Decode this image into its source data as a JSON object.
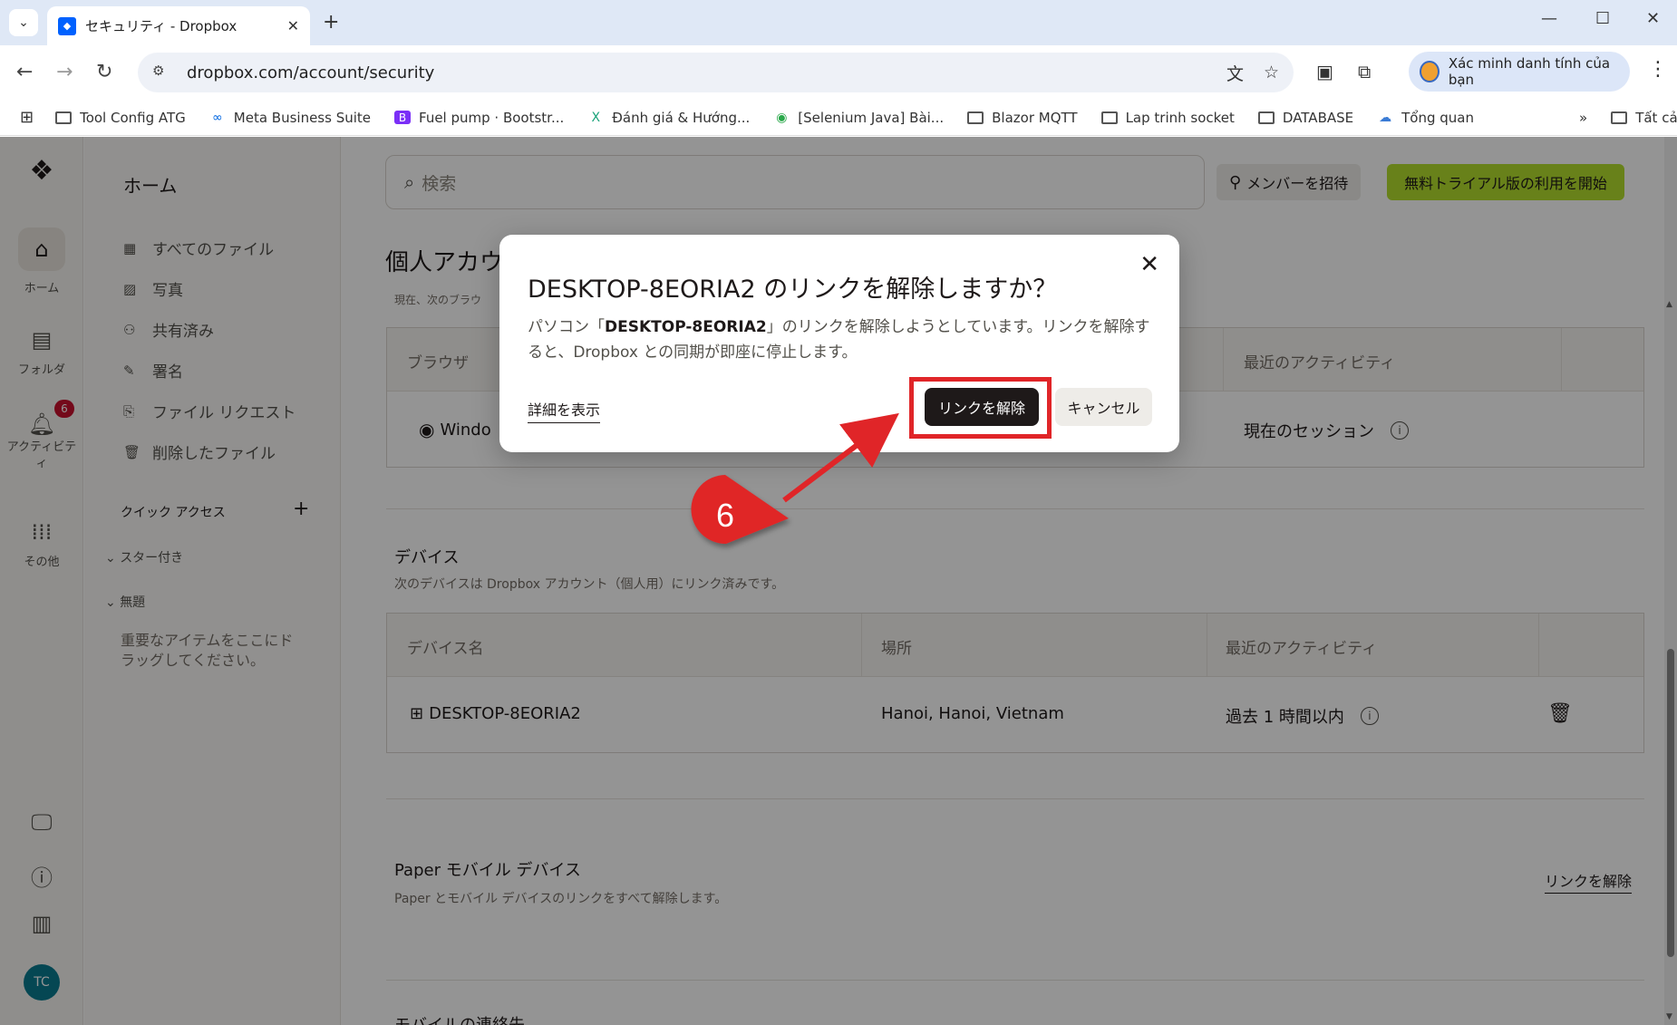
{
  "browser": {
    "tab_title": "セキュリティ - Dropbox",
    "url": "dropbox.com/account/security",
    "profile_label": "Xác minh danh tính của bạn",
    "bookmarks": [
      {
        "label": "Tool Config ATG",
        "icon": "folder-icon"
      },
      {
        "label": "Meta Business Suite",
        "icon": "meta-icon"
      },
      {
        "label": "Fuel pump · Bootstr...",
        "icon": "bootstrap-icon"
      },
      {
        "label": "Đánh giá & Hướng...",
        "icon": "x-icon"
      },
      {
        "label": "[Selenium Java] Bài...",
        "icon": "selenium-icon"
      },
      {
        "label": "Blazor MQTT",
        "icon": "folder-icon"
      },
      {
        "label": "Lap trinh socket",
        "icon": "folder-icon"
      },
      {
        "label": "DATABASE",
        "icon": "folder-icon"
      },
      {
        "label": "Tổng quan",
        "icon": "web-icon"
      }
    ],
    "all_bookmarks_label": "Tất cả dấu trang"
  },
  "rail": {
    "home_label": "ホーム",
    "folder_label": "フォルダ",
    "activity_label": "アクティビティ",
    "activity_badge": "6",
    "more_label": "その他",
    "avatar_initials": "TC"
  },
  "sidebar": {
    "home": "ホーム",
    "items": [
      {
        "label": "すべてのファイル",
        "icon": "files-icon"
      },
      {
        "label": "写真",
        "icon": "photo-icon"
      },
      {
        "label": "共有済み",
        "icon": "shared-icon"
      },
      {
        "label": "署名",
        "icon": "signature-icon"
      },
      {
        "label": "ファイル リクエスト",
        "icon": "file-request-icon"
      },
      {
        "label": "削除したファイル",
        "icon": "trash-icon"
      }
    ],
    "quick_access": "クイック アクセス",
    "starred": "スター付き",
    "untitled": "無題",
    "hint": "重要なアイテムをここにドラッグしてください。"
  },
  "header": {
    "search_placeholder": "検索",
    "invite_label": "メンバーを招待",
    "trial_label": "無料トライアル版の利用を開始"
  },
  "personal": {
    "title": "個人アカウ",
    "subtitle": "現在、次のブラウ",
    "columns": [
      "ブラウザ",
      "最近のアクティビティ"
    ],
    "row": {
      "browser": "Windo",
      "activity": "現在のセッション"
    }
  },
  "devices": {
    "title": "デバイス",
    "subtitle": "次のデバイスは Dropbox アカウント（個人用）にリンク済みです。",
    "columns": [
      "デバイス名",
      "場所",
      "最近のアクティビティ"
    ],
    "rows": [
      {
        "name": "DESKTOP-8EORIA2",
        "location": "Hanoi, Hanoi, Vietnam",
        "activity": "過去 1 時間以内"
      }
    ]
  },
  "paper": {
    "title": "Paper モバイル デバイス",
    "subtitle": "Paper とモバイル デバイスのリンクをすべて解除します。",
    "unlink_label": "リンクを解除"
  },
  "mobile_contacts": {
    "title": "モバイルの連絡先"
  },
  "modal": {
    "title": "DESKTOP-8EORIA2 のリンクを解除しますか？",
    "body_prefix": "パソコン「",
    "body_device": "DESKTOP-8EORIA2",
    "body_suffix": "」のリンクを解除しようとしています。リンクを解除すると、Dropbox との同期が即座に停止します。",
    "details_label": "詳細を表示",
    "unlink_button": "リンクを解除",
    "cancel_button": "キャンセル"
  },
  "annotation": {
    "step": "6",
    "highlight_color": "#e02528"
  }
}
